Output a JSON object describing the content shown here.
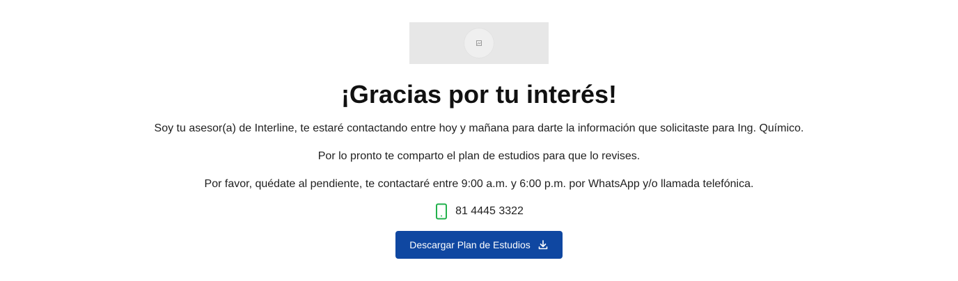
{
  "hero": {
    "image_icon": "image-placeholder-icon"
  },
  "content": {
    "title": "¡Gracias por tu interés!",
    "paragraph_1": "Soy tu asesor(a) de Interline, te estaré contactando entre hoy y mañana para darte la información que solicitaste para Ing. Químico.",
    "paragraph_2": "Por lo pronto te comparto el plan de estudios para que lo revises.",
    "paragraph_3": "Por favor, quédate al pendiente, te contactaré entre 9:00 a.m. y 6:00 p.m. por WhatsApp y/o llamada telefónica."
  },
  "contact": {
    "phone_icon": "phone-icon",
    "phone_number": "81 4445 3322"
  },
  "cta": {
    "label": "Descargar Plan de Estudios",
    "icon": "download-icon"
  },
  "colors": {
    "button_bg": "#0f47a1",
    "phone_icon": "#22b14c",
    "text": "#1f1f1f"
  }
}
